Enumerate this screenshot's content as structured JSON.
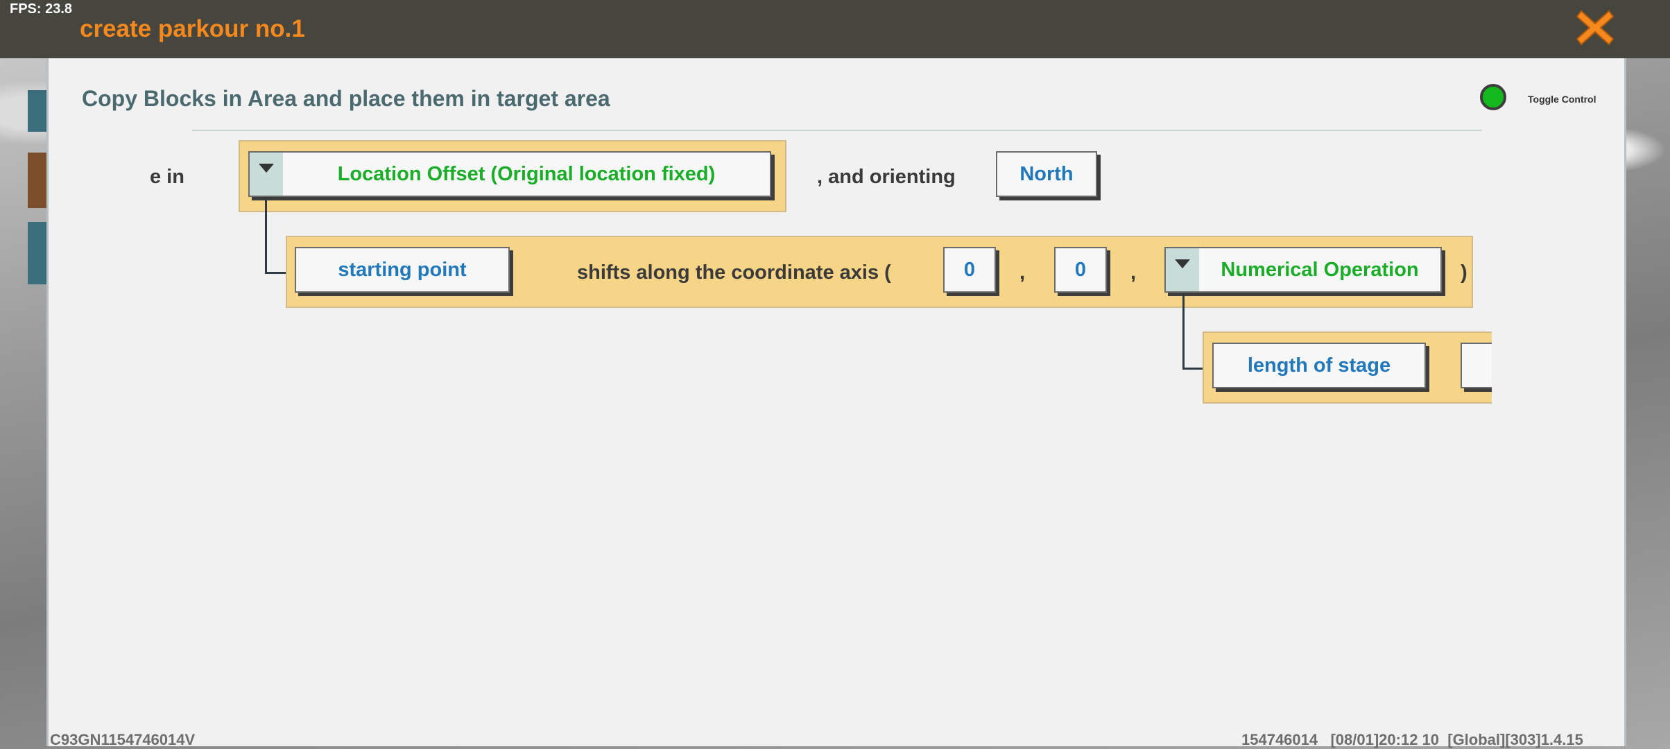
{
  "hud": {
    "fps": "FPS: 23.8"
  },
  "window": {
    "title": "create parkour no.1",
    "close_icon": "close-x-icon",
    "accent_color": "#f5891e"
  },
  "panel": {
    "heading": "Copy Blocks in Area and place them in target area",
    "toggle_label": "Toggle Control",
    "toggle_color": "#12b81c"
  },
  "blocks": {
    "row1_prefix": "e in",
    "location_dropdown": "Location Offset (Original location fixed)",
    "orienting_text": ", and orienting",
    "orientation_value": "North",
    "starting_point": "starting point",
    "shift_text": "shifts along the coordinate axis (",
    "x_value": "0",
    "comma1": ",",
    "y_value": "0",
    "comma2": ",",
    "numerical_dropdown": "Numerical Operation",
    "close_paren": ")",
    "length_of_stage": "length of stage"
  },
  "footer": {
    "left": "C93GN1154746014V",
    "right": "154746014   [08/01]20:12 10  [Global][303]1.4.15"
  }
}
